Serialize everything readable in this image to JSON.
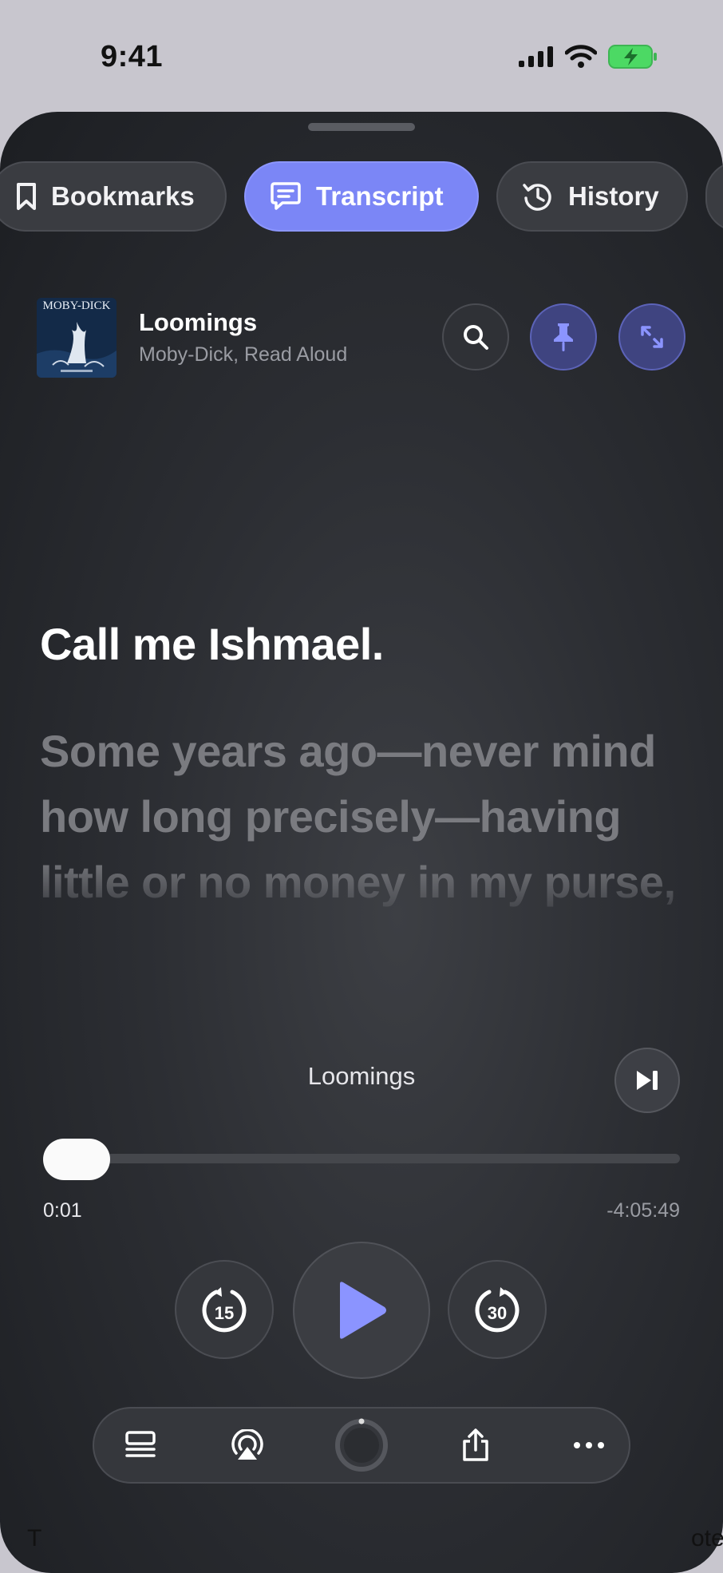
{
  "status_bar": {
    "time": "9:41"
  },
  "tabs": [
    {
      "label": "Bookmarks",
      "icon": "bookmark-icon",
      "active": false
    },
    {
      "label": "Transcript",
      "icon": "transcript-icon",
      "active": true
    },
    {
      "label": "History",
      "icon": "history-icon",
      "active": false
    }
  ],
  "episode": {
    "artwork_text": "MOBY-DICK",
    "title": "Loomings",
    "subtitle": "Moby-Dick, Read Aloud"
  },
  "transcript": {
    "current_line": "Call me Ishmael.",
    "next_line": "Some years ago—never mind how long precisely—having little or no money in my purse,"
  },
  "player": {
    "chapter": "Loomings",
    "elapsed": "0:01",
    "remaining": "-4:05:49",
    "skip_back_seconds": "15",
    "skip_forward_seconds": "30",
    "progress_fraction": 0.0001
  },
  "background_hints": {
    "left": "T",
    "right": "ote"
  },
  "colors": {
    "accent": "#7b86f6",
    "sheet_bg": "#2c2e33"
  }
}
